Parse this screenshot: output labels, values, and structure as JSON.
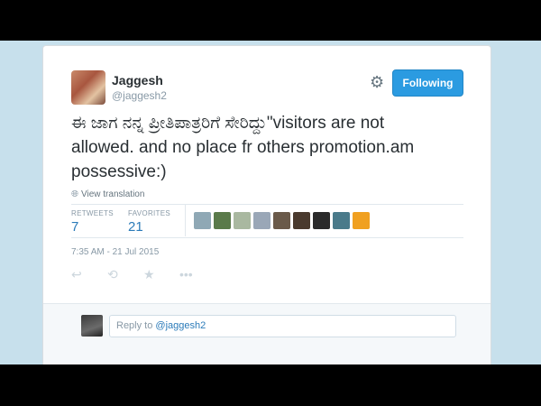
{
  "user": {
    "name": "Jaggesh",
    "handle": "@jaggesh2"
  },
  "follow_button": {
    "label": "Following"
  },
  "tweet": {
    "text": "ಈ ಜಾಗ ನನ್ನ ಪ್ರೀತಿಪಾತ್ರರಿಗೆ ಸೇರಿದ್ದು\"visitors are not allowed. and no place fr others promotion.am possessive:)",
    "view_translation": "View translation"
  },
  "stats": {
    "retweets_label": "RETWEETS",
    "retweets": "7",
    "favorites_label": "FAVORITES",
    "favorites": "21"
  },
  "favoriters_colors": [
    "#8fa8b5",
    "#5a7a4a",
    "#a9b8a0",
    "#9aa7b7",
    "#6a5a4a",
    "#4a3a2e",
    "#2a2a2a",
    "#4a7a8a",
    "#f0a020"
  ],
  "timestamp": "7:35 AM - 21 Jul 2015",
  "icons": [
    "reply-icon",
    "retweet-icon",
    "favorite-icon",
    "more-icon",
    "gear-icon",
    "globe-icon"
  ],
  "reply": {
    "prefix": "Reply to ",
    "mention": "@jaggesh2"
  }
}
